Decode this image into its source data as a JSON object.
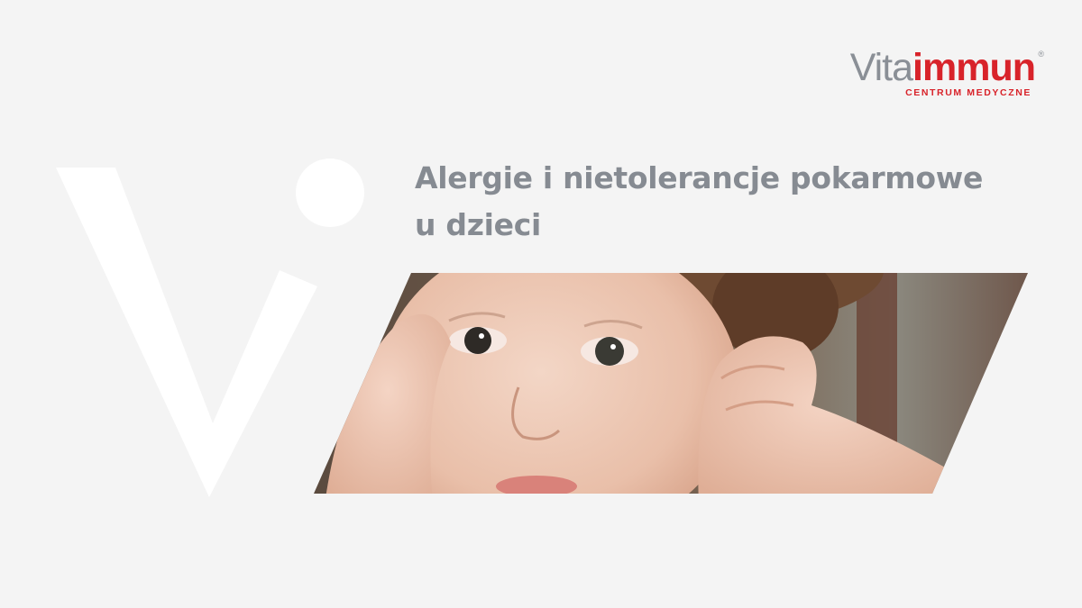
{
  "brand": {
    "name_part1": "Vita",
    "name_part2": "immun",
    "registered_mark": "®",
    "tagline": "CENTRUM MEDYCZNE",
    "colors": {
      "gray": "#8a8f96",
      "red": "#d8232a"
    }
  },
  "article": {
    "title_line1": "Alergie i nietolerancje pokarmowe",
    "title_line2": "u dzieci"
  },
  "photo": {
    "subject": "child-covering-ears-photo"
  },
  "background_color": "#f4f4f4"
}
